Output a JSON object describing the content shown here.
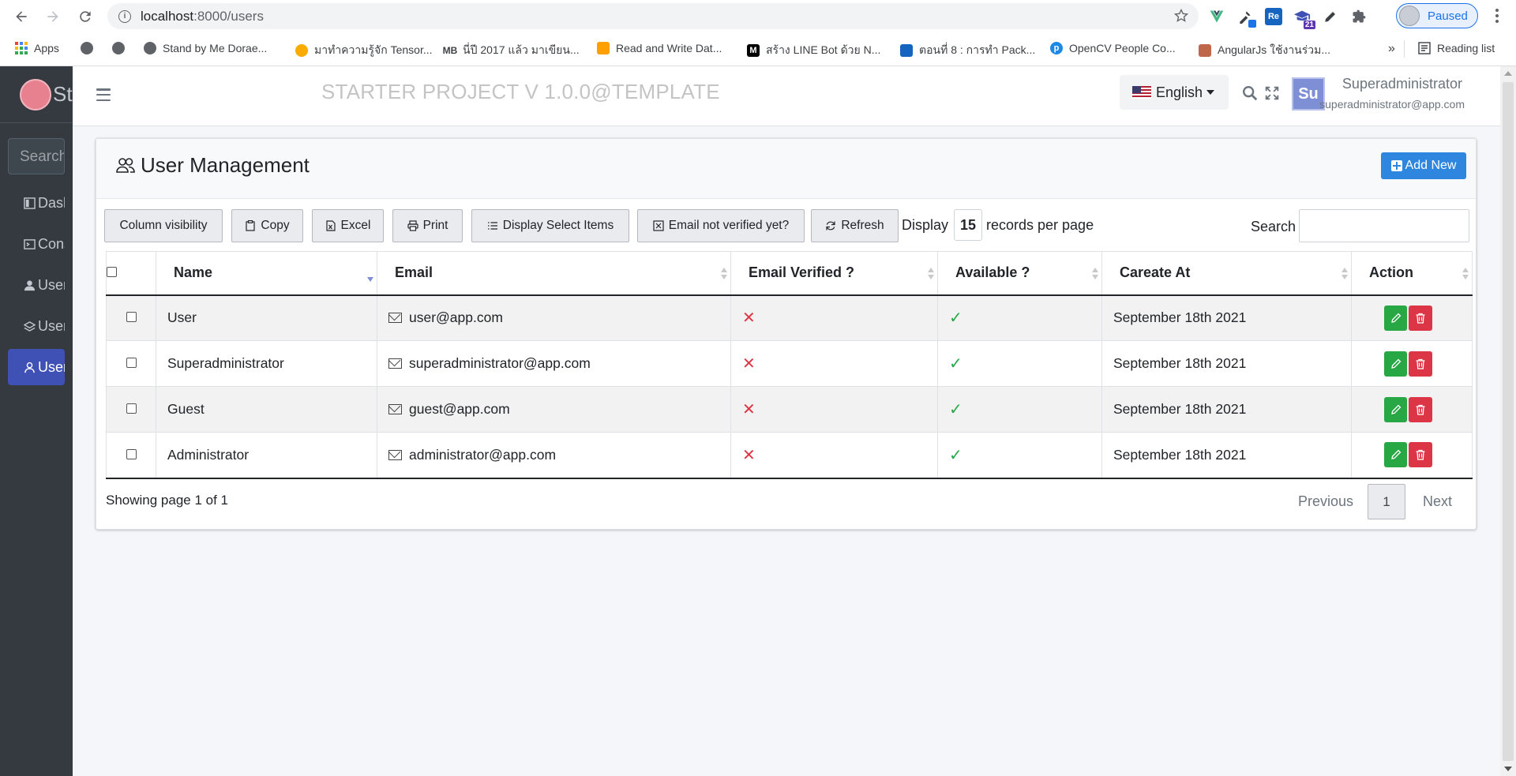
{
  "browser": {
    "url_host": "localhost",
    "url_path": ":8000/users",
    "profile_status": "Paused",
    "bookmarks": [
      {
        "label": "Apps"
      },
      {
        "label": ""
      },
      {
        "label": ""
      },
      {
        "label": "Stand by Me Dorae..."
      },
      {
        "label": "มาทำความรู้จัก Tensor..."
      },
      {
        "label": "นี่ปี 2017 แล้ว มาเขียน..."
      },
      {
        "label": "Read and Write Dat..."
      },
      {
        "label": "สร้าง LINE Bot ด้วย N..."
      },
      {
        "label": "ตอนที่ 8 : การทำ Pack..."
      },
      {
        "label": "OpenCV People Co..."
      },
      {
        "label": "AngularJs ใช้งานร่วม..."
      }
    ],
    "more_bookmarks": "»",
    "reading_list": "Reading list",
    "extensions_badge": "21"
  },
  "sidebar": {
    "brand_text": "St",
    "search_placeholder": "Search",
    "items": [
      {
        "label": "Dashboard"
      },
      {
        "label": "Console"
      },
      {
        "label": "User"
      },
      {
        "label": "User"
      },
      {
        "label": "User"
      }
    ]
  },
  "header": {
    "title": "STARTER PROJECT V 1.0.0@TEMPLATE",
    "language": "English",
    "avatar_initials": "Su",
    "user_name": "Superadministrator",
    "user_email": "superadministrator@app.com"
  },
  "card": {
    "title": "User Management",
    "add_button": "Add New",
    "toolbar": {
      "column_visibility": "Column visibility",
      "copy": "Copy",
      "excel": "Excel",
      "print": "Print",
      "display_select": "Display Select Items",
      "email_not_verified": "Email not verified yet?",
      "refresh": "Refresh"
    },
    "display_label": "Display",
    "display_value": "15",
    "display_suffix": "records per page",
    "search_label": "Search",
    "columns": [
      "Name",
      "Email",
      "Email Verified ?",
      "Available ?",
      "Careate At",
      "Action"
    ],
    "rows": [
      {
        "name": "User",
        "email": "user@app.com",
        "verified": "✕",
        "available": "✓",
        "created": "September 18th 2021"
      },
      {
        "name": "Superadministrator",
        "email": "superadministrator@app.com",
        "verified": "✕",
        "available": "✓",
        "created": "September 18th 2021"
      },
      {
        "name": "Guest",
        "email": "guest@app.com",
        "verified": "✕",
        "available": "✓",
        "created": "September 18th 2021"
      },
      {
        "name": "Administrator",
        "email": "administrator@app.com",
        "verified": "✕",
        "available": "✓",
        "created": "September 18th 2021"
      }
    ],
    "info": "Showing page 1 of 1",
    "pager": {
      "prev": "Previous",
      "page": "1",
      "next": "Next"
    }
  },
  "colors": {
    "sidebar_bg": "#343a40",
    "active_item": "#3f51b5",
    "primary": "#2e86de",
    "success": "#28a745",
    "danger": "#dc3545"
  }
}
